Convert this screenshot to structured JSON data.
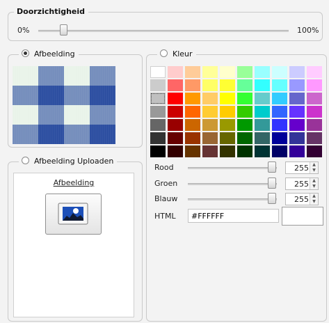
{
  "opacity": {
    "title": "Doorzichtigheid",
    "min_label": "0%",
    "max_label": "100%",
    "value_fraction": 0.1
  },
  "image_option": {
    "label": "Afbeelding",
    "selected": true,
    "preview_colors": [
      "#2b4da0",
      "#e9f3e9"
    ]
  },
  "color_option": {
    "label": "Kleur",
    "selected": false
  },
  "upload_option": {
    "label": "Afbeelding Uploaden",
    "selected": false,
    "link_label": "Afbeelding",
    "button_icon": "image-icon"
  },
  "palette": [
    [
      "#FFFFFF",
      "#FFCCCC",
      "#FFCC99",
      "#FFFF99",
      "#FFFFCC",
      "#99FF99",
      "#99FFFF",
      "#CCFFFF",
      "#CCCCFF",
      "#FFCCFF"
    ],
    [
      "#CCCCCC",
      "#FF6666",
      "#FF9966",
      "#FFFF66",
      "#FFFF33",
      "#66FF99",
      "#33FFFF",
      "#66FFFF",
      "#9999FF",
      "#FF99FF"
    ],
    [
      "#C0C0C0",
      "#FF0000",
      "#FF9900",
      "#FFCC66",
      "#FFFF00",
      "#33FF33",
      "#66CCCC",
      "#33CCFF",
      "#6666CC",
      "#CC66CC"
    ],
    [
      "#999999",
      "#CC0000",
      "#FF6600",
      "#FFCC33",
      "#FFCC00",
      "#33CC00",
      "#00CCCC",
      "#3366FF",
      "#6633FF",
      "#CC33CC"
    ],
    [
      "#666666",
      "#990000",
      "#CC6600",
      "#CC9933",
      "#999900",
      "#009900",
      "#339999",
      "#3333FF",
      "#6600CC",
      "#993399"
    ],
    [
      "#333333",
      "#660000",
      "#993300",
      "#996633",
      "#666600",
      "#006600",
      "#336666",
      "#000099",
      "#333399",
      "#663366"
    ],
    [
      "#000000",
      "#330000",
      "#663300",
      "#663333",
      "#333300",
      "#003300",
      "#003333",
      "#000066",
      "#330099",
      "#330033"
    ]
  ],
  "rgb": [
    {
      "label": "Rood",
      "value": "255",
      "fraction": 1.0
    },
    {
      "label": "Groen",
      "value": "255",
      "fraction": 1.0
    },
    {
      "label": "Blauw",
      "value": "255",
      "fraction": 1.0
    }
  ],
  "html": {
    "label": "HTML",
    "value": "#FFFFFF",
    "preview_color": "#FFFFFF"
  },
  "spinner_arrows": {
    "up": "▲",
    "down": "▼"
  }
}
